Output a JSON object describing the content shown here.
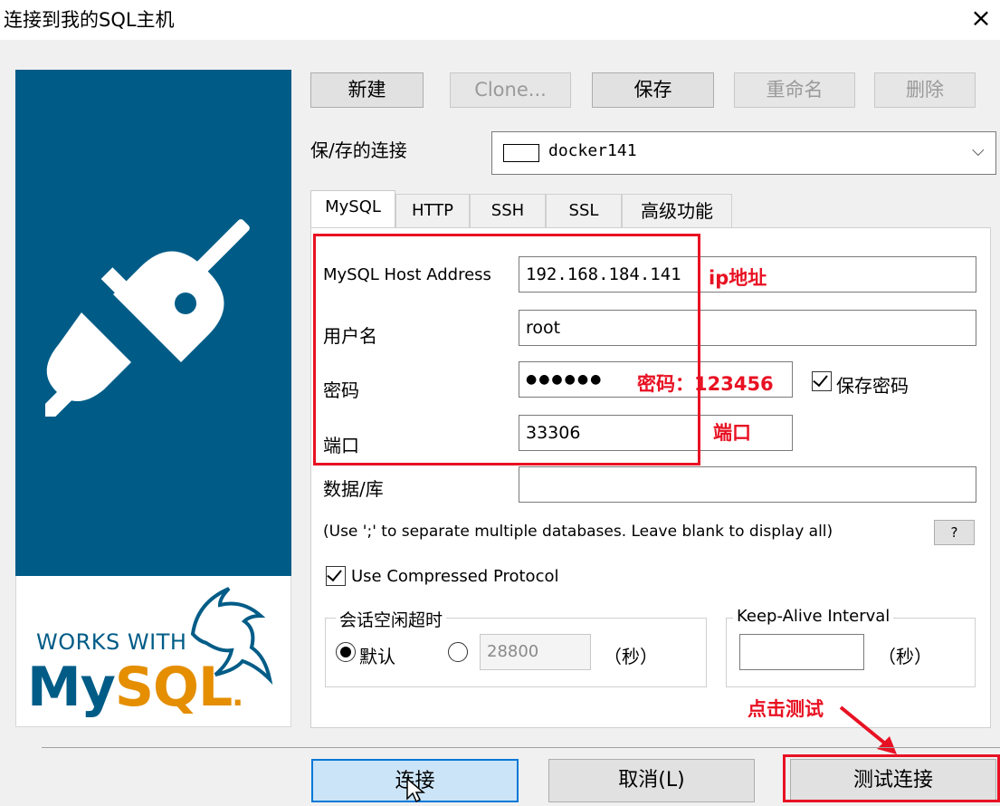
{
  "window": {
    "title": "连接到我的SQL主机",
    "close_label": "×"
  },
  "logo": {
    "works_with": "WORKS WITH",
    "brand_my": "My",
    "brand_sql": "SQL",
    "brand_mark": "."
  },
  "toolbar": {
    "new_label": "新建",
    "clone_label": "Clone...",
    "save_label": "保存",
    "rename_label": "重命名",
    "delete_label": "删除"
  },
  "saved_connection": {
    "label": "保/存的连接",
    "value": "docker141"
  },
  "tabs": [
    {
      "label": "MySQL",
      "active": true
    },
    {
      "label": "HTTP"
    },
    {
      "label": "SSH"
    },
    {
      "label": "SSL"
    },
    {
      "label": "高级功能"
    }
  ],
  "form": {
    "host_label": "MySQL Host Address",
    "host_value": "192.168.184.141",
    "user_label": "用户名",
    "user_value": "root",
    "password_label": "密码",
    "password_value": "●●●●●●",
    "save_password_label": "保存密码",
    "port_label": "端口",
    "port_value": "33306",
    "database_label": "数据/库",
    "database_value": "",
    "database_hint": "(Use ';' to separate multiple databases. Leave blank to display all)",
    "help_label": "?",
    "compressed_label": "Use Compressed Protocol",
    "session_group_label": "会话空闲超时",
    "default_option_label": "默认",
    "timeout_value": "28800",
    "seconds_label": "（秒）",
    "keepalive_group_label": "Keep-Alive Interval",
    "keepalive_value": "",
    "keepalive_seconds_label": "（秒）"
  },
  "annotations": {
    "ip": "ip地址",
    "password": "密码：123456",
    "port": "端口",
    "click_test": "点击测试"
  },
  "footer": {
    "connect_label": "连接",
    "cancel_label": "取消(L)",
    "test_label": "测试连接"
  },
  "colors": {
    "brand_blue": "#005c87",
    "brand_orange": "#e48e00",
    "annotation_red": "#e81123",
    "focus_blue": "#0078d7"
  },
  "icons": [
    "close-icon",
    "plug-icon",
    "dolphin-icon",
    "chevron-down-icon",
    "db-color-icon",
    "arrow-annotation-icon",
    "mouse-cursor-icon"
  ]
}
